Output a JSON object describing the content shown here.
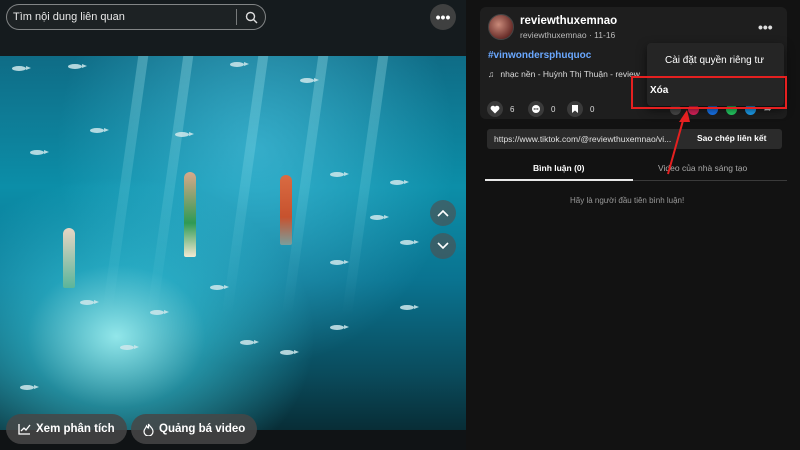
{
  "search": {
    "placeholder": "Tìm nội dung liên quan"
  },
  "video_actions": {
    "analytics_label": "Xem phân tích",
    "promote_label": "Quảng bá video"
  },
  "post": {
    "username": "reviewthuxemnao",
    "handle_date": "reviewthuxemnao · 11-16",
    "hashtag": "#vinwondersphuquoc",
    "music": "nhạc nền - Huỳnh Thị Thuận - review",
    "likes": "6",
    "comments": "0",
    "saves": "0",
    "link": "https://www.tiktok.com/@reviewthuxemnao/vi...",
    "copy_link": "Sao chép liên kết"
  },
  "tabs": {
    "comments": "Bình luận (0)",
    "creator_videos": "Video của nhà sáng tạo"
  },
  "empty_comments": "Hãy là người đầu tiên bình luận!",
  "menu": {
    "privacy": "Cài đặt quyền riêng tư",
    "delete": "Xóa"
  },
  "colors": {
    "accent_red": "#e52020",
    "hashtag_blue": "#6aa8ff"
  },
  "icons": [
    "search-icon",
    "more-icon",
    "chevron-up-icon",
    "chevron-down-icon",
    "chart-icon",
    "flame-icon",
    "heart-icon",
    "comment-icon",
    "bookmark-icon",
    "music-icon"
  ]
}
